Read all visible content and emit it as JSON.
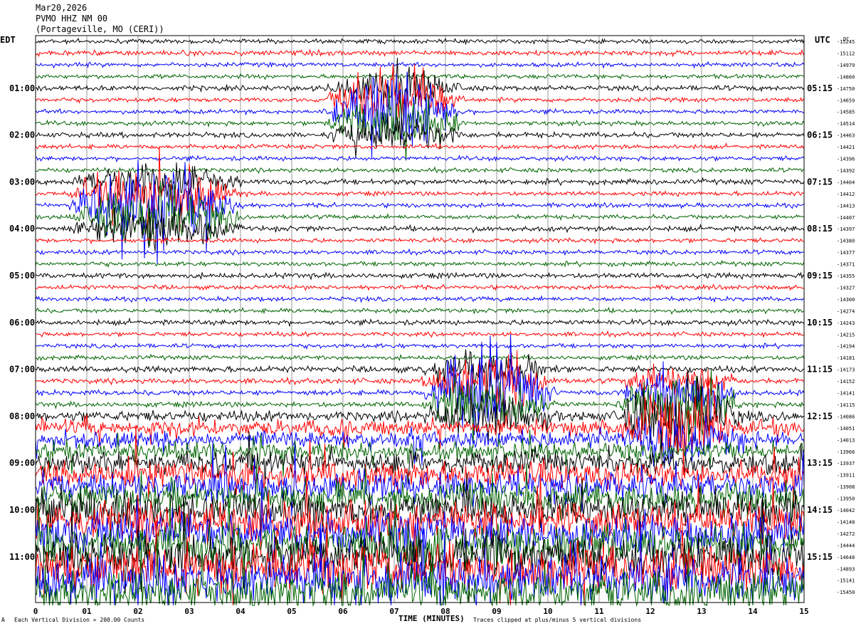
{
  "header": {
    "date": "Mar20,2026",
    "station": "PVMO HHZ NM 00",
    "location": "(Portageville, MO (CERI))"
  },
  "left_zone_label": "EDT",
  "right_zone_label": "UTC",
  "dc_label": "DC",
  "footer": {
    "corner_mark": "A",
    "scale_note": "Each Vertical Division = 200.00 Counts",
    "xlabel": "TIME (MINUTES)",
    "clip_note": "Traces clipped at plus/minus 5 vertical divisions"
  },
  "colors": {
    "trace_cycle": [
      "#000000",
      "#ff0000",
      "#0000ff",
      "#006400"
    ],
    "grid": "#999999",
    "background": "#ffffff"
  },
  "chart_data": {
    "type": "line",
    "title": "PVMO HHZ NM 00",
    "xlabel": "TIME (MINUTES)",
    "xlim": [
      0,
      15
    ],
    "x_ticks": [
      "0",
      "01",
      "02",
      "03",
      "04",
      "05",
      "06",
      "07",
      "08",
      "09",
      "10",
      "11",
      "12",
      "13",
      "14",
      "15"
    ],
    "rows_per_hour": 4,
    "left_hour_labels": [
      "01:00",
      "02:00",
      "03:00",
      "04:00",
      "05:00",
      "06:00",
      "07:00",
      "08:00",
      "09:00",
      "10:00",
      "11:00"
    ],
    "right_hour_labels": [
      "05:15",
      "06:15",
      "07:15",
      "08:15",
      "09:15",
      "10:15",
      "11:15",
      "12:15",
      "13:15",
      "14:15",
      "15:15"
    ],
    "trace_dc_offsets": [
      -15245,
      -15112,
      -14979,
      -14860,
      -14750,
      -14659,
      -14585,
      -14514,
      -14463,
      -14421,
      -14396,
      -14392,
      -14404,
      -14412,
      -14413,
      -14407,
      -14397,
      -14380,
      -14377,
      -14371,
      -14355,
      -14327,
      -14300,
      -14274,
      -14243,
      -14215,
      -14194,
      -14181,
      -14173,
      -14152,
      -14141,
      -14115,
      -14086,
      -14051,
      -14013,
      -13966,
      -13937,
      -13911,
      -13908,
      -13950,
      -14042,
      -14148,
      -14272,
      -14444,
      -14648,
      -14893,
      -15141,
      -15450
    ],
    "noise_amplitude_divisions": [
      0.25,
      0.3,
      0.25,
      0.25,
      0.3,
      0.25,
      0.25,
      0.25,
      0.3,
      0.25,
      0.25,
      0.25,
      0.3,
      0.25,
      0.25,
      0.25,
      0.3,
      0.25,
      0.25,
      0.25,
      0.3,
      0.25,
      0.25,
      0.25,
      0.3,
      0.25,
      0.25,
      0.25,
      0.35,
      0.3,
      0.3,
      0.3,
      0.6,
      0.9,
      1.0,
      1.0,
      1.3,
      1.5,
      1.6,
      1.8,
      2.0,
      2.2,
      2.3,
      2.5,
      2.6,
      2.8,
      2.8,
      2.4
    ],
    "events": [
      {
        "trace_start": 4,
        "trace_end": 8,
        "minute_start": 5.6,
        "minute_end": 8.4,
        "peak_minute": 7.3,
        "amplitude_divisions": 5
      },
      {
        "trace_start": 12,
        "trace_end": 16,
        "minute_start": 0.6,
        "minute_end": 4.1,
        "peak_minute": 1.7,
        "amplitude_divisions": 5
      },
      {
        "trace_start": 28,
        "trace_end": 32,
        "minute_start": 7.5,
        "minute_end": 10.2,
        "peak_minute": 8.7,
        "amplitude_divisions": 5
      },
      {
        "trace_start": 29,
        "trace_end": 34,
        "minute_start": 11.3,
        "minute_end": 13.8,
        "peak_minute": 12.4,
        "amplitude_divisions": 5
      }
    ],
    "clip_divisions": 5
  }
}
